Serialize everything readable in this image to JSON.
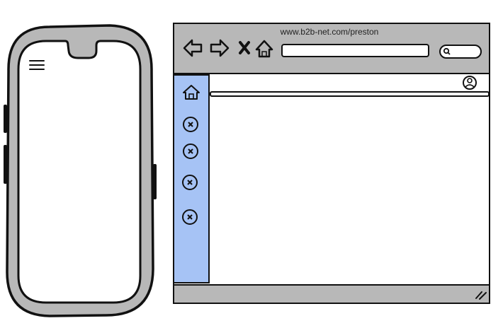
{
  "browser": {
    "url_label": "www.b2b-net.com/preston",
    "address_value": "",
    "search_value": ""
  },
  "colors": {
    "chrome": "#b8b8b8",
    "sidebar": "#a6c3f5",
    "stroke": "#111111"
  },
  "icons": {
    "mobile_menu": "hamburger-menu-icon",
    "back": "back-arrow-icon",
    "forward": "forward-arrow-icon",
    "stop": "stop-x-icon",
    "home": "home-icon",
    "search": "search-icon",
    "user": "user-icon",
    "sidebar_home": "home-icon",
    "sidebar_items": [
      "close-circle-icon",
      "close-circle-icon",
      "close-circle-icon",
      "close-circle-icon"
    ],
    "resize": "resize-grip-icon"
  }
}
